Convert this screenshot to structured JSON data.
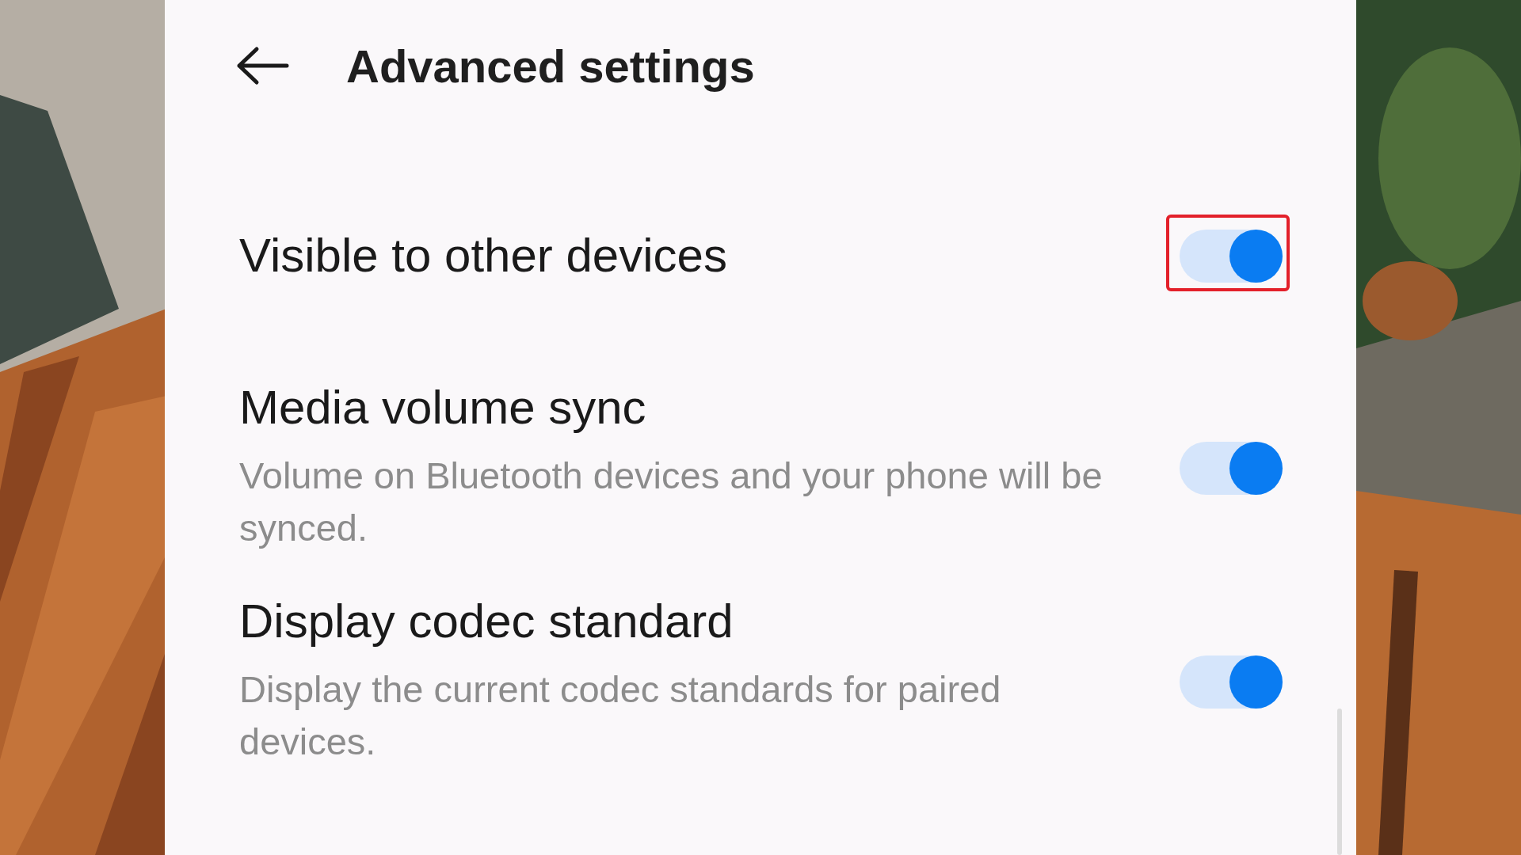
{
  "header": {
    "title": "Advanced settings"
  },
  "items": [
    {
      "title": "Visible to other devices",
      "on": true,
      "highlighted": true
    },
    {
      "title": "Media volume sync",
      "description": "Volume on Bluetooth devices and your phone will be synced.",
      "on": true,
      "highlighted": false
    },
    {
      "title": "Display codec standard",
      "description": "Display the current codec standards for paired devices.",
      "on": true,
      "highlighted": false
    }
  ]
}
